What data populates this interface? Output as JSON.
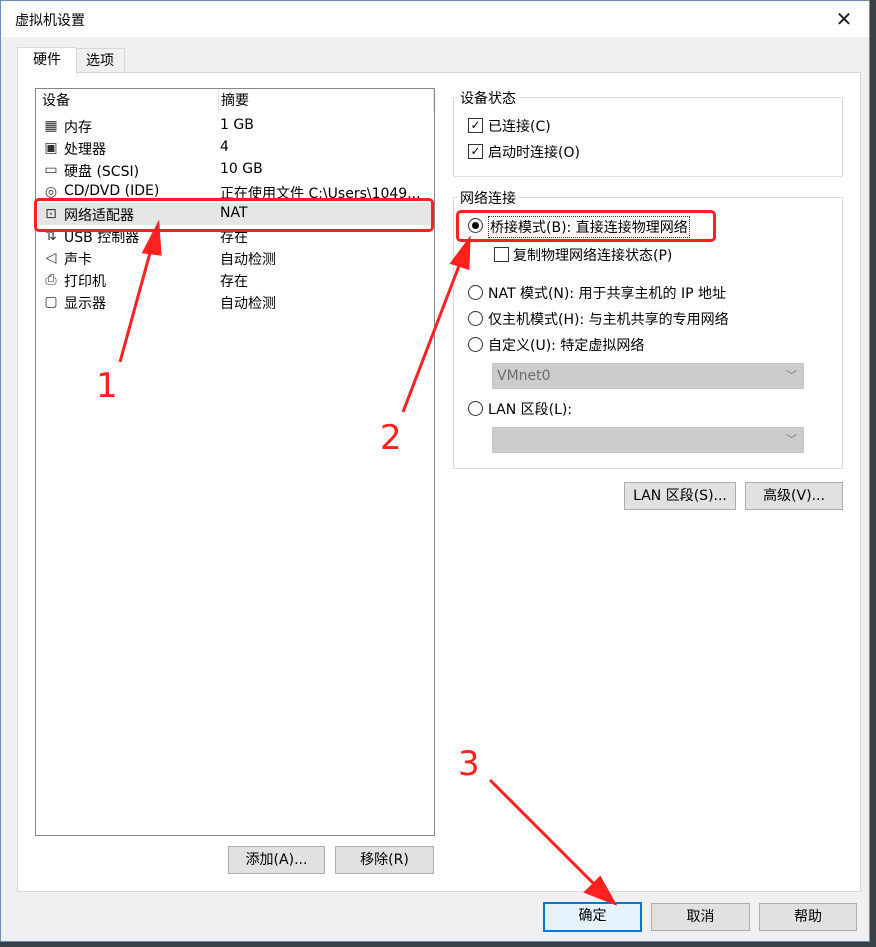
{
  "window": {
    "title": "虚拟机设置",
    "close_label": "✕"
  },
  "tabs": [
    {
      "label": "硬件"
    },
    {
      "label": "选项"
    }
  ],
  "device_list": {
    "headers": {
      "device": "设备",
      "summary": "摘要"
    },
    "rows": [
      {
        "icon": "memory-icon",
        "name": "内存",
        "summary": "1 GB"
      },
      {
        "icon": "processor-icon",
        "name": "处理器",
        "summary": "4"
      },
      {
        "icon": "hard-disk-icon",
        "name": "硬盘 (SCSI)",
        "summary": "10 GB"
      },
      {
        "icon": "cd-dvd-icon",
        "name": "CD/DVD (IDE)",
        "summary": "正在使用文件 C:\\Users\\1049..."
      },
      {
        "icon": "network-adapter-icon",
        "name": "网络适配器",
        "summary": "NAT"
      },
      {
        "icon": "usb-icon",
        "name": "USB 控制器",
        "summary": "存在"
      },
      {
        "icon": "sound-card-icon",
        "name": "声卡",
        "summary": "自动检测"
      },
      {
        "icon": "printer-icon",
        "name": "打印机",
        "summary": "存在"
      },
      {
        "icon": "display-icon",
        "name": "显示器",
        "summary": "自动检测"
      }
    ],
    "selected_index": 4,
    "add_button": "添加(A)...",
    "remove_button": "移除(R)"
  },
  "device_status": {
    "title": "设备状态",
    "connected": {
      "label": "已连接(C)",
      "checked": true
    },
    "connect_at_power_on": {
      "label": "启动时连接(O)",
      "checked": true
    }
  },
  "network_connection": {
    "title": "网络连接",
    "bridged": {
      "label": "桥接模式(B): 直接连接物理网络",
      "selected": true
    },
    "replicate": {
      "label": "复制物理网络连接状态(P)",
      "checked": false
    },
    "nat": {
      "label": "NAT 模式(N): 用于共享主机的 IP 地址",
      "selected": false
    },
    "host_only": {
      "label": "仅主机模式(H): 与主机共享的专用网络",
      "selected": false
    },
    "custom": {
      "label": "自定义(U): 特定虚拟网络",
      "selected": false
    },
    "custom_select_value": "VMnet0",
    "lan_segment": {
      "label": "LAN 区段(L):",
      "selected": false
    },
    "lan_select_value": ""
  },
  "buttons": {
    "lan_segments": "LAN 区段(S)...",
    "advanced": "高级(V)...",
    "ok": "确定",
    "cancel": "取消",
    "help": "帮助"
  },
  "annotations": {
    "one": "1",
    "two": "2",
    "three": "3"
  },
  "colors": {
    "annotation_red": "#ff2020",
    "default_button_border": "#0078d7"
  }
}
